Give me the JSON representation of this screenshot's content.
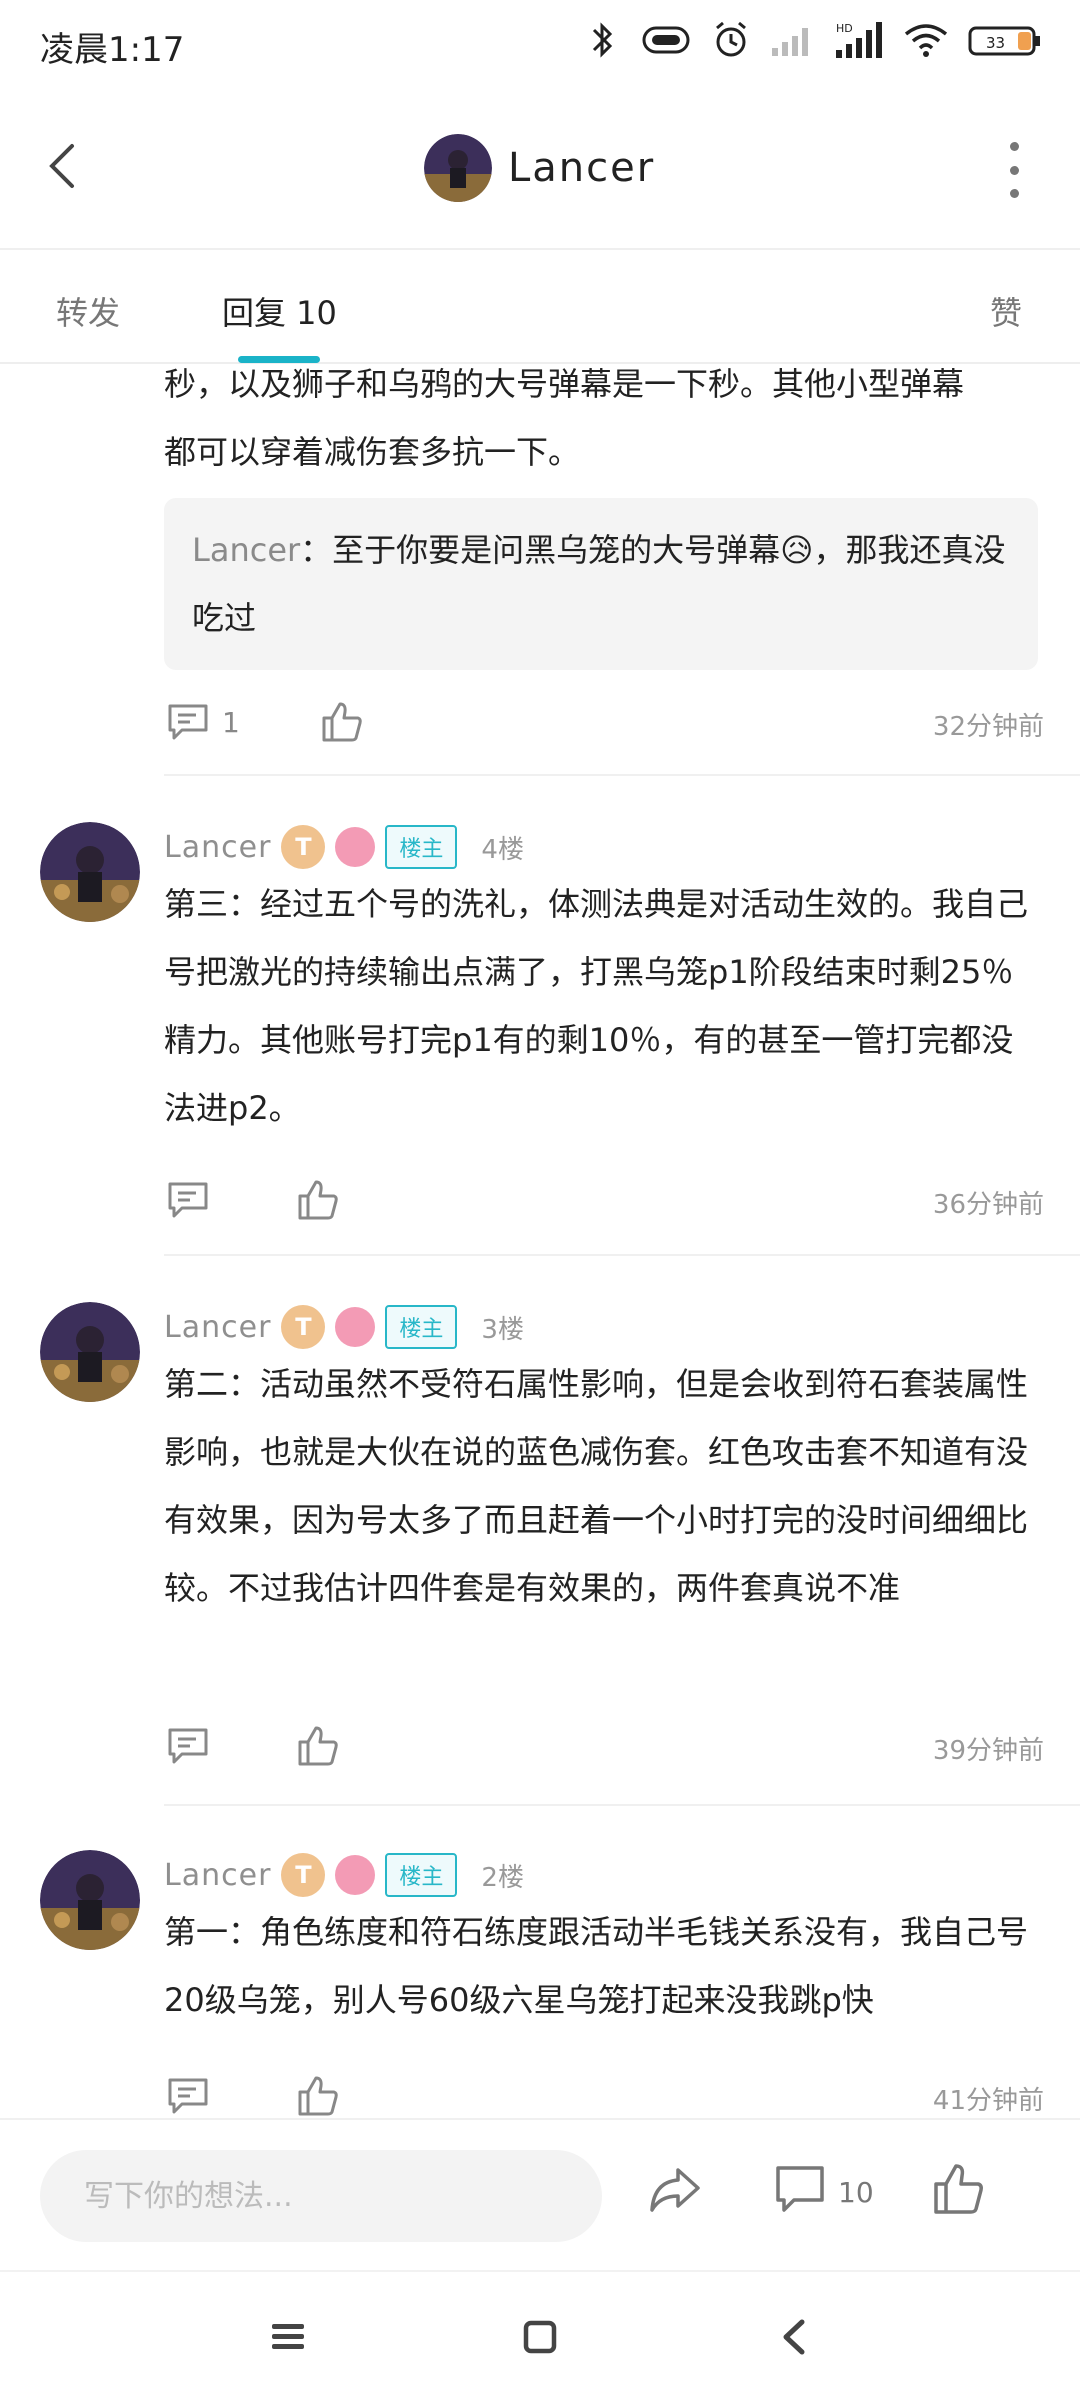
{
  "status_bar": {
    "time": "凌晨1:17",
    "battery": "33"
  },
  "header": {
    "title": "Lancer"
  },
  "tabs": [
    {
      "label": "转发"
    },
    {
      "label": "回复 10"
    },
    {
      "label": "赞"
    }
  ],
  "partial_post": {
    "text_lines": [
      "秒，以及狮子和乌鸦的大号弹幕是一下秒。其他小型弹幕",
      "都可以穿着减伤套多抗一下。"
    ],
    "quote": {
      "name": "Lancer",
      "text": "：至于你要是问黑乌笼的大号弹幕😥，那我还真没吃过"
    },
    "comment_count": "1",
    "time": "32分钟前"
  },
  "floors": [
    {
      "username": "Lancer",
      "badge_t": "T",
      "host_badge": "楼主",
      "floor": "4楼",
      "text": "第三：经过五个号的洗礼，体测法典是对活动生效的。我自己号把激光的持续输出点满了，打黑乌笼p1阶段结束时剩25％精力。其他账号打完p1有的剩10％，有的甚至一管打完都没法进p2。",
      "time": "36分钟前"
    },
    {
      "username": "Lancer",
      "badge_t": "T",
      "host_badge": "楼主",
      "floor": "3楼",
      "text": "第二：活动虽然不受符石属性影响，但是会收到符石套装属性影响，也就是大伙在说的蓝色减伤套。红色攻击套不知道有没有效果，因为号太多了而且赶着一个小时打完的没时间细细比较。不过我估计四件套是有效果的，两件套真说不准",
      "time": "39分钟前"
    },
    {
      "username": "Lancer",
      "badge_t": "T",
      "host_badge": "楼主",
      "floor": "2楼",
      "text": "第一：角色练度和符石练度跟活动半毛钱关系没有，我自己号20级乌笼，别人号60级六星乌笼打起来没我跳p快",
      "time": "41分钟前"
    }
  ],
  "bottom_bar": {
    "placeholder": "写下你的想法...",
    "comment_count": "10"
  },
  "colors": {
    "accent": "#1ab3c8",
    "host_badge": "#28b7c8",
    "quote_bg": "#f4f4f4"
  }
}
